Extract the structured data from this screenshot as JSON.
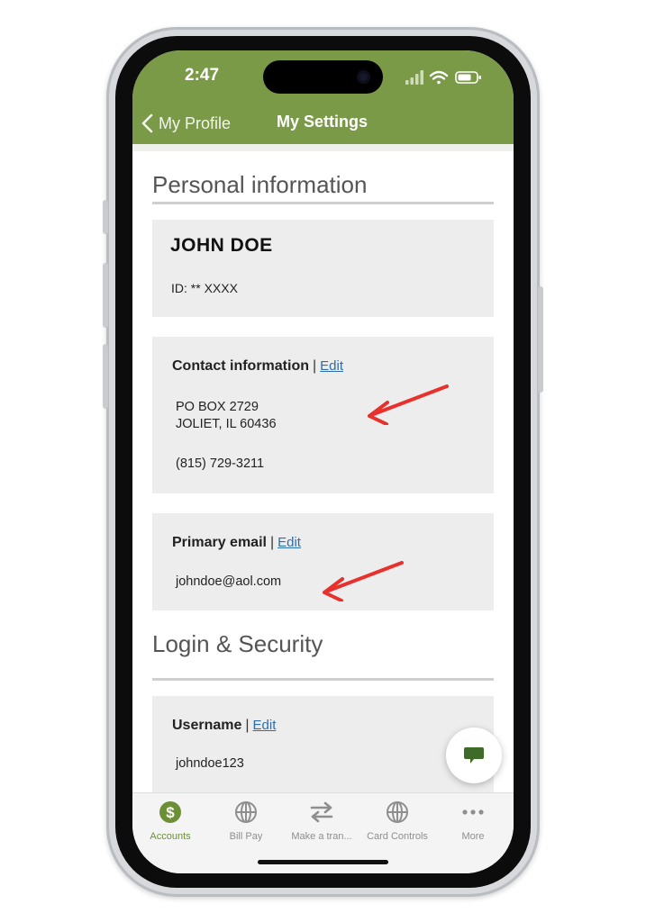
{
  "status_bar": {
    "time": "2:47"
  },
  "nav": {
    "back_label": "My Profile",
    "title": "My Settings"
  },
  "personal_info": {
    "section_title": "Personal information",
    "name": "JOHN DOE",
    "id_line": "ID: ** XXXX"
  },
  "contact": {
    "heading": "Contact information",
    "separator": "|",
    "edit_label": "Edit",
    "address_line1": "PO BOX 2729",
    "address_line2": "JOLIET, IL 60436",
    "phone": "(815) 729-3211"
  },
  "email": {
    "heading": "Primary email",
    "separator": "|",
    "edit_label": "Edit",
    "value": "johndoe@aol.com"
  },
  "login_security": {
    "section_title": "Login & Security",
    "username_heading": "Username",
    "separator": "|",
    "edit_label": "Edit",
    "username_value": "johndoe123"
  },
  "tabs": [
    {
      "label": "Accounts",
      "icon": "dollar-circle-icon",
      "active": true
    },
    {
      "label": "Bill Pay",
      "icon": "globe-icon",
      "active": false
    },
    {
      "label": "Make a tran...",
      "icon": "transfer-arrows-icon",
      "active": false
    },
    {
      "label": "Card Controls",
      "icon": "globe-icon",
      "active": false
    },
    {
      "label": "More",
      "icon": "more-dots-icon",
      "active": false
    }
  ],
  "colors": {
    "header_green": "#7a9a47",
    "active_tab_green": "#6c8f35",
    "link_blue": "#2d6ea8",
    "annotation_red": "#e8302c",
    "chat_icon_green": "#3f6b2a"
  }
}
